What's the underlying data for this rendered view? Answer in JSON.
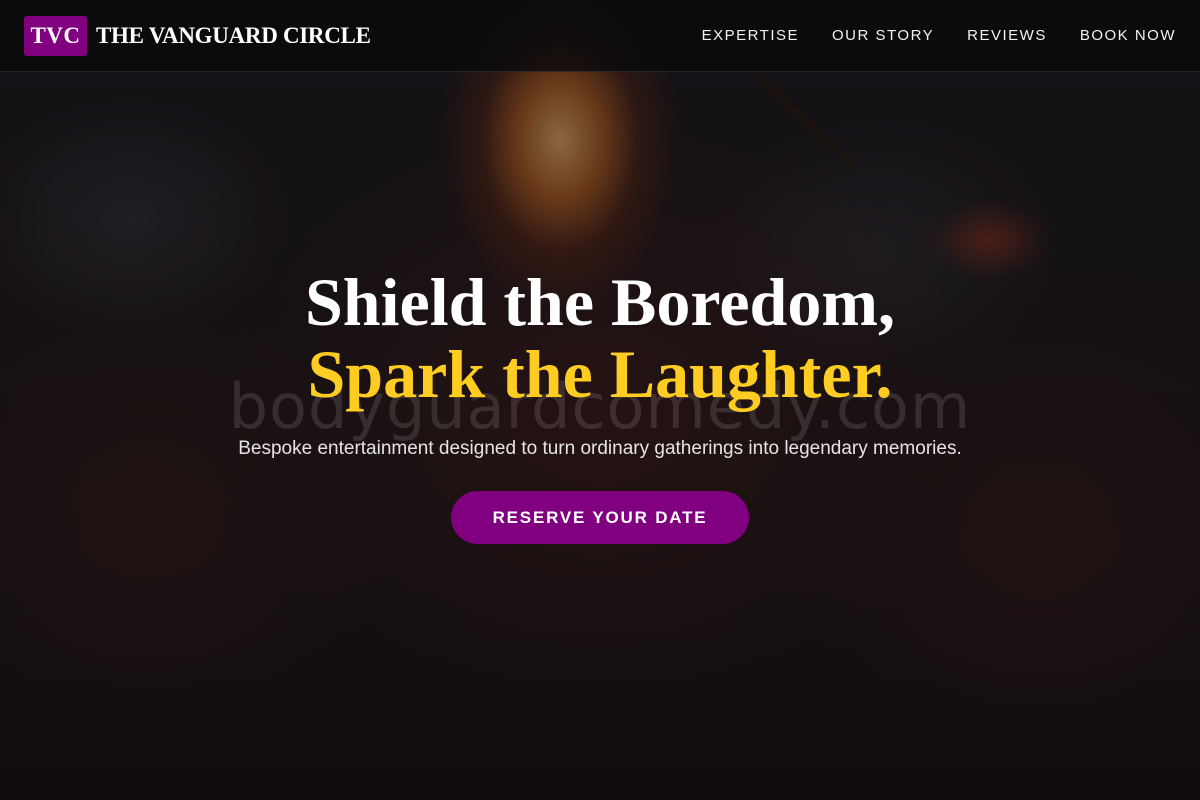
{
  "header": {
    "logo_text": "TVC",
    "brand_name": "THE VANGUARD CIRCLE",
    "nav": [
      {
        "label": "EXPERTISE"
      },
      {
        "label": "OUR STORY"
      },
      {
        "label": "REVIEWS"
      },
      {
        "label": "BOOK NOW"
      }
    ]
  },
  "hero": {
    "headline_line1": "Shield the Boredom,",
    "headline_line2": "Spark the Laughter.",
    "subtitle": "Bespoke entertainment designed to turn ordinary gatherings into legendary memories.",
    "cta_label": "RESERVE YOUR DATE",
    "watermark": "bodyguardcomedy.com",
    "background_image": "fire-performer-crowd-photo"
  },
  "colors": {
    "accent": "#800080",
    "highlight": "#ffcc22",
    "header_bg": "#0a0a0c"
  }
}
